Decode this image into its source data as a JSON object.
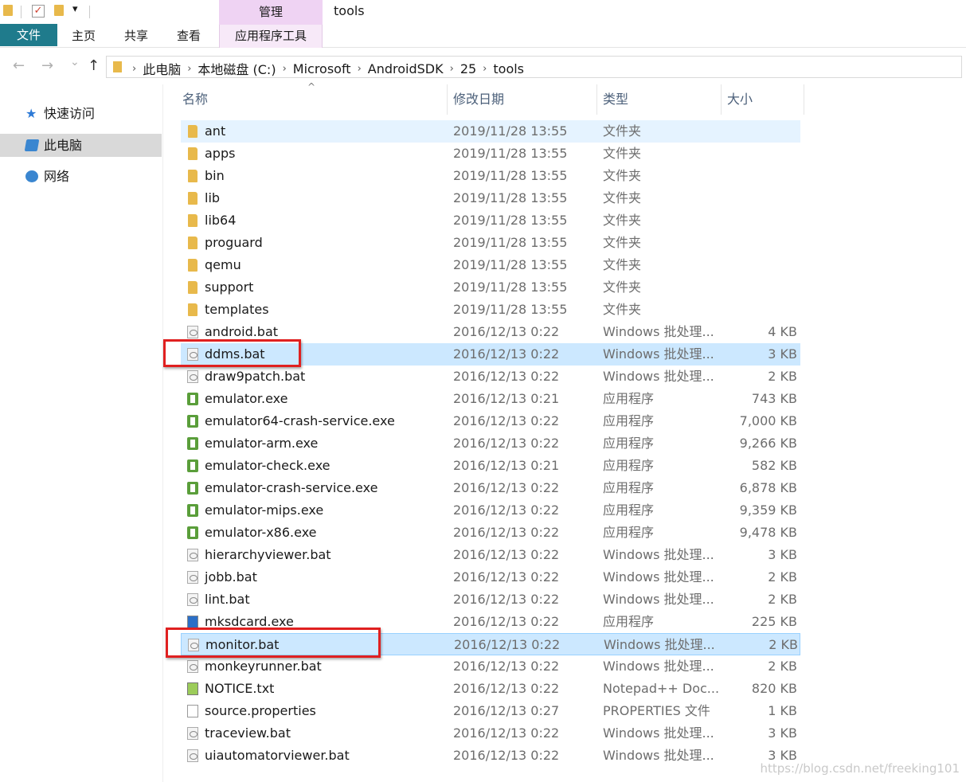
{
  "quick_access": {
    "customize_label": "▾"
  },
  "context_tab_header": "管理",
  "window_title": "tools",
  "ribbon": {
    "tabs": [
      {
        "label": "文件"
      },
      {
        "label": "主页"
      },
      {
        "label": "共享"
      },
      {
        "label": "查看"
      },
      {
        "label": "应用程序工具"
      }
    ]
  },
  "nav": {
    "back": "←",
    "forward": "→",
    "recent": "⌄",
    "up": "↑"
  },
  "breadcrumb": [
    "此电脑",
    "本地磁盘 (C:)",
    "Microsoft",
    "AndroidSDK",
    "25",
    "tools"
  ],
  "navpane": {
    "items": [
      {
        "label": "快速访问",
        "icon": "star-icon"
      },
      {
        "label": "此电脑",
        "icon": "computer-icon",
        "selected": true
      },
      {
        "label": "网络",
        "icon": "network-icon"
      }
    ]
  },
  "columns": {
    "name": "名称",
    "date": "修改日期",
    "type": "类型",
    "size": "大小"
  },
  "files": [
    {
      "name": "ant",
      "date": "2019/11/28 13:55",
      "type": "文件夹",
      "size": "",
      "icon": "folder-icon",
      "state": "hover"
    },
    {
      "name": "apps",
      "date": "2019/11/28 13:55",
      "type": "文件夹",
      "size": "",
      "icon": "folder-icon"
    },
    {
      "name": "bin",
      "date": "2019/11/28 13:55",
      "type": "文件夹",
      "size": "",
      "icon": "folder-icon"
    },
    {
      "name": "lib",
      "date": "2019/11/28 13:55",
      "type": "文件夹",
      "size": "",
      "icon": "folder-icon"
    },
    {
      "name": "lib64",
      "date": "2019/11/28 13:55",
      "type": "文件夹",
      "size": "",
      "icon": "folder-icon"
    },
    {
      "name": "proguard",
      "date": "2019/11/28 13:55",
      "type": "文件夹",
      "size": "",
      "icon": "folder-icon"
    },
    {
      "name": "qemu",
      "date": "2019/11/28 13:55",
      "type": "文件夹",
      "size": "",
      "icon": "folder-icon"
    },
    {
      "name": "support",
      "date": "2019/11/28 13:55",
      "type": "文件夹",
      "size": "",
      "icon": "folder-icon"
    },
    {
      "name": "templates",
      "date": "2019/11/28 13:55",
      "type": "文件夹",
      "size": "",
      "icon": "folder-icon"
    },
    {
      "name": "android.bat",
      "date": "2016/12/13 0:22",
      "type": "Windows 批处理...",
      "size": "4 KB",
      "icon": "batch-file-icon"
    },
    {
      "name": "ddms.bat",
      "date": "2016/12/13 0:22",
      "type": "Windows 批处理...",
      "size": "3 KB",
      "icon": "batch-file-icon",
      "state": "selected"
    },
    {
      "name": "draw9patch.bat",
      "date": "2016/12/13 0:22",
      "type": "Windows 批处理...",
      "size": "2 KB",
      "icon": "batch-file-icon"
    },
    {
      "name": "emulator.exe",
      "date": "2016/12/13 0:21",
      "type": "应用程序",
      "size": "743 KB",
      "icon": "android-exe-icon"
    },
    {
      "name": "emulator64-crash-service.exe",
      "date": "2016/12/13 0:22",
      "type": "应用程序",
      "size": "7,000 KB",
      "icon": "android-exe-icon"
    },
    {
      "name": "emulator-arm.exe",
      "date": "2016/12/13 0:22",
      "type": "应用程序",
      "size": "9,266 KB",
      "icon": "android-exe-icon"
    },
    {
      "name": "emulator-check.exe",
      "date": "2016/12/13 0:21",
      "type": "应用程序",
      "size": "582 KB",
      "icon": "android-exe-icon"
    },
    {
      "name": "emulator-crash-service.exe",
      "date": "2016/12/13 0:22",
      "type": "应用程序",
      "size": "6,878 KB",
      "icon": "android-exe-icon"
    },
    {
      "name": "emulator-mips.exe",
      "date": "2016/12/13 0:22",
      "type": "应用程序",
      "size": "9,359 KB",
      "icon": "android-exe-icon"
    },
    {
      "name": "emulator-x86.exe",
      "date": "2016/12/13 0:22",
      "type": "应用程序",
      "size": "9,478 KB",
      "icon": "android-exe-icon"
    },
    {
      "name": "hierarchyviewer.bat",
      "date": "2016/12/13 0:22",
      "type": "Windows 批处理...",
      "size": "3 KB",
      "icon": "batch-file-icon"
    },
    {
      "name": "jobb.bat",
      "date": "2016/12/13 0:22",
      "type": "Windows 批处理...",
      "size": "2 KB",
      "icon": "batch-file-icon"
    },
    {
      "name": "lint.bat",
      "date": "2016/12/13 0:22",
      "type": "Windows 批处理...",
      "size": "2 KB",
      "icon": "batch-file-icon"
    },
    {
      "name": "mksdcard.exe",
      "date": "2016/12/13 0:22",
      "type": "应用程序",
      "size": "225 KB",
      "icon": "exe-icon"
    },
    {
      "name": "monitor.bat",
      "date": "2016/12/13 0:22",
      "type": "Windows 批处理...",
      "size": "2 KB",
      "icon": "batch-file-icon",
      "state": "selected-focus"
    },
    {
      "name": "monkeyrunner.bat",
      "date": "2016/12/13 0:22",
      "type": "Windows 批处理...",
      "size": "2 KB",
      "icon": "batch-file-icon"
    },
    {
      "name": "NOTICE.txt",
      "date": "2016/12/13 0:22",
      "type": "Notepad++ Doc...",
      "size": "820 KB",
      "icon": "notepad-file-icon"
    },
    {
      "name": "source.properties",
      "date": "2016/12/13 0:27",
      "type": "PROPERTIES 文件",
      "size": "1 KB",
      "icon": "file-icon"
    },
    {
      "name": "traceview.bat",
      "date": "2016/12/13 0:22",
      "type": "Windows 批处理...",
      "size": "3 KB",
      "icon": "batch-file-icon"
    },
    {
      "name": "uiautomatorviewer.bat",
      "date": "2016/12/13 0:22",
      "type": "Windows 批处理...",
      "size": "3 KB",
      "icon": "batch-file-icon"
    }
  ],
  "watermark": "https://blog.csdn.net/freeking101"
}
